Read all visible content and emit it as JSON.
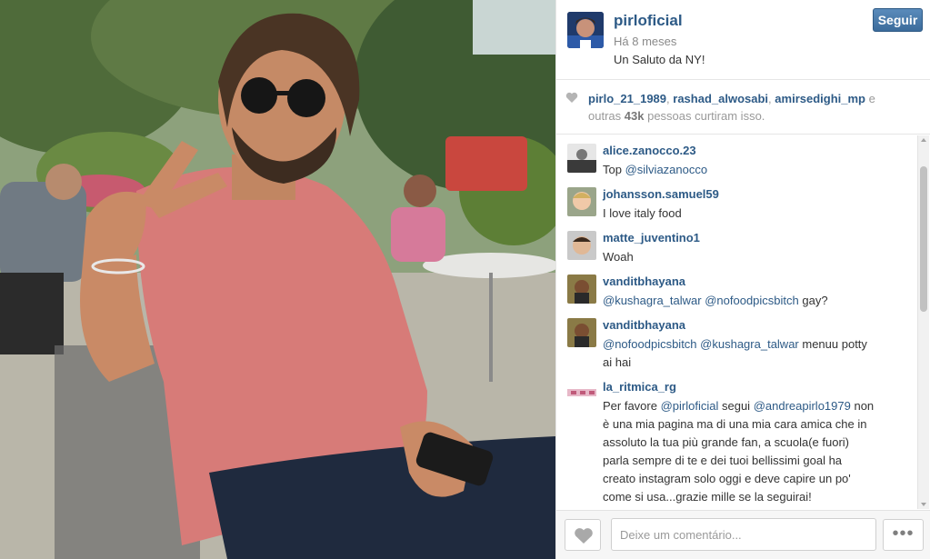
{
  "post": {
    "username": "pirloficial",
    "time_ago": "Há 8 meses",
    "caption": "Un Saluto da NY!",
    "follow_label": "Seguir"
  },
  "likes": {
    "user1": "pirlo_21_1989",
    "sep1": ",",
    "user2": "rashad_alwosabi",
    "sep2": ",",
    "user3": "amirsedighi_mp",
    "and_text": "e outras",
    "count": "43k",
    "suffix": "pessoas curtiram isso."
  },
  "comments": [
    {
      "username": "alice.zanocco.23",
      "parts": [
        {
          "t": "Top ",
          "m": false
        },
        {
          "t": "@silviazanocco",
          "m": true
        }
      ]
    },
    {
      "username": "johansson.samuel59",
      "parts": [
        {
          "t": "I love italy food",
          "m": false
        }
      ]
    },
    {
      "username": "matte_juventino1",
      "parts": [
        {
          "t": "Woah",
          "m": false
        }
      ]
    },
    {
      "username": "vanditbhayana",
      "parts": [
        {
          "t": "@kushagra_talwar",
          "m": true
        },
        {
          "t": " ",
          "m": false
        },
        {
          "t": "@nofoodpicsbitch",
          "m": true
        },
        {
          "t": " gay?",
          "m": false
        }
      ]
    },
    {
      "username": "vanditbhayana",
      "parts": [
        {
          "t": "@nofoodpicsbitch",
          "m": true
        },
        {
          "t": " ",
          "m": false
        },
        {
          "t": "@kushagra_talwar",
          "m": true
        },
        {
          "t": " menuu potty ai hai",
          "m": false
        }
      ]
    },
    {
      "username": "la_ritmica_rg",
      "parts": [
        {
          "t": "Per favore ",
          "m": false
        },
        {
          "t": "@pirloficial",
          "m": true
        },
        {
          "t": " segui ",
          "m": false
        },
        {
          "t": "@andreapirlo1979",
          "m": true
        },
        {
          "t": " non è una mia pagina ma di una mia cara amica che in assoluto la tua più grande fan, a scuola(e fuori) parla sempre di te e dei tuoi bellissimi goal ha creato instagram solo oggi e deve capire un po' come si usa...grazie mille se la seguirai!",
          "m": false
        }
      ]
    }
  ],
  "footer": {
    "comment_placeholder": "Deixe um comentário...",
    "more_label": "•••"
  },
  "colors": {
    "link_blue": "#2d5a86",
    "follow_button": "#4a7aab"
  },
  "icons": {
    "like": "heart-icon",
    "more": "ellipsis-icon"
  }
}
